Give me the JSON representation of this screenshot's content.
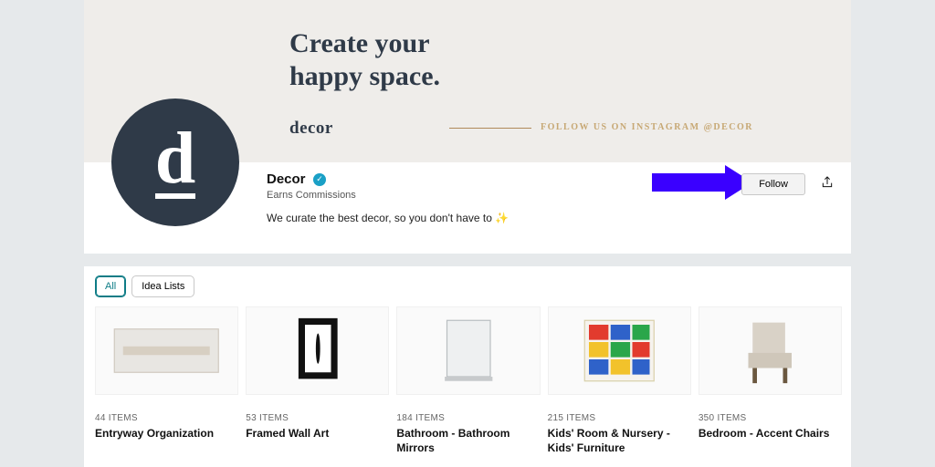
{
  "banner": {
    "line1": "Create your",
    "line2": "happy space.",
    "sub": "decor",
    "follow_text": "FOLLOW US ON INSTAGRAM @DECOR"
  },
  "profile": {
    "avatar_letter": "d",
    "name": "Decor",
    "commission": "Earns Commissions",
    "desc": "We curate the best decor, so you don't have to ✨",
    "follow_button": "Follow"
  },
  "tabs": {
    "all": "All",
    "idea_lists": "Idea Lists"
  },
  "cards": [
    {
      "count": "44 ITEMS",
      "title": "Entryway Organization"
    },
    {
      "count": "53 ITEMS",
      "title": "Framed Wall Art"
    },
    {
      "count": "184 ITEMS",
      "title": "Bathroom - Bathroom Mirrors"
    },
    {
      "count": "215 ITEMS",
      "title": "Kids' Room & Nursery - Kids' Furniture"
    },
    {
      "count": "350 ITEMS",
      "title": "Bedroom - Accent Chairs"
    }
  ]
}
